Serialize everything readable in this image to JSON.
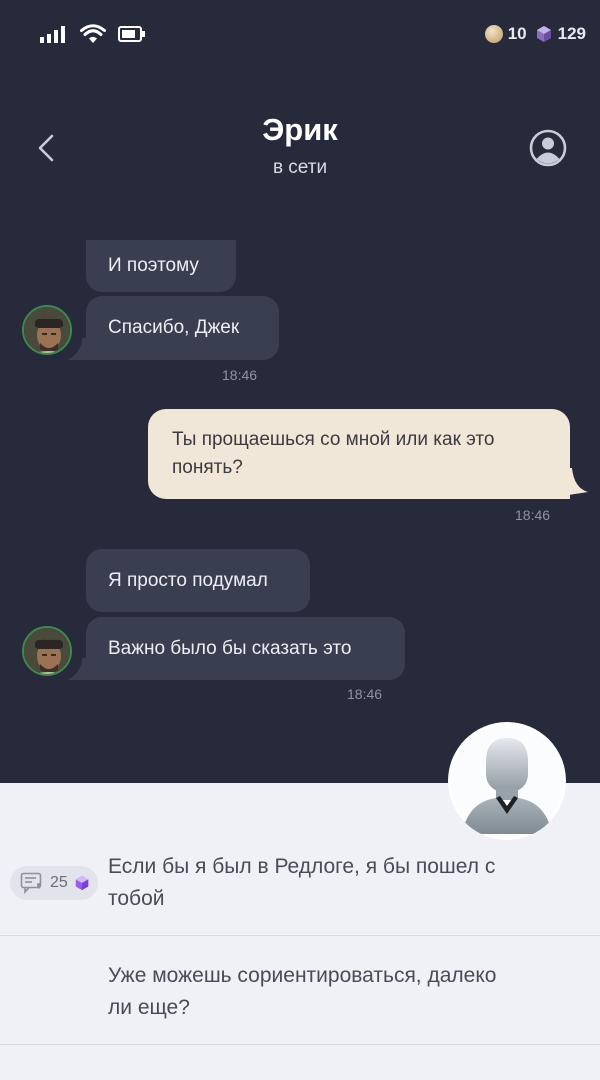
{
  "status_bar": {
    "coins": "10",
    "gems": "129",
    "icons": [
      "signal-icon",
      "wifi-icon",
      "battery-icon",
      "coin-icon",
      "gem-icon"
    ]
  },
  "header": {
    "title": "Эрик",
    "status": "в сети"
  },
  "messages": [
    {
      "text": "И поэтому",
      "side": "in"
    },
    {
      "text": "Спасибо, Джек",
      "side": "in"
    },
    {
      "time": "18:46"
    },
    {
      "text": "Ты прощаешься со мной или как это понять?",
      "line1": "Ты прощаешься со мной или как это",
      "line2": "понять?",
      "side": "out"
    },
    {
      "time": "18:46"
    },
    {
      "text": "Я просто подумал",
      "side": "in"
    },
    {
      "text": "Важно было бы сказать это",
      "side": "in"
    },
    {
      "time": "18:46"
    }
  ],
  "choices": [
    {
      "line1": "Если бы я был в Редлоге, я бы пошел с",
      "line2": "тобой",
      "cost": "25"
    },
    {
      "line1": "Уже можешь сориентироваться, далеко",
      "line2": "ли еще?"
    }
  ],
  "colors": {
    "background": "#262a3b",
    "incoming_bubble": "#3a3e51",
    "outgoing_bubble": "#f1e7d8",
    "panel": "#f0f0f7",
    "gem_purple": "#9b5de5"
  }
}
